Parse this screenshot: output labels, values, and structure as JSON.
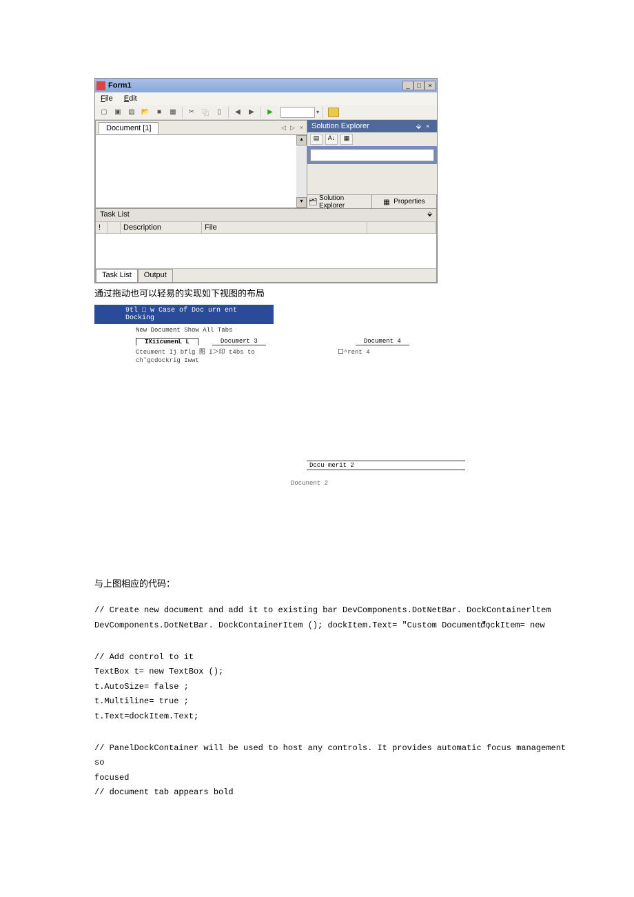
{
  "form1": {
    "title": "Form1",
    "menu": {
      "file": "File",
      "edit": "Edit"
    },
    "doc_tab": "Document [1]",
    "solution": {
      "title": "Solution Explorer",
      "tab1": "Solution Explorer",
      "tab2": "Properties"
    },
    "tasklist": {
      "title": "Task List",
      "cols": {
        "desc": "Description",
        "file": "File"
      },
      "tabs": {
        "tasklist": "Task List",
        "output": "Output"
      }
    }
  },
  "caption1": "通过拖动也可以轻易的实现如下视图的布局",
  "fig2": {
    "title": "9tl □ w Case of Doc urn ent Docking",
    "sub": "New Document Show All Tabs",
    "tabs": [
      "IXiicumenL L",
      "Documert 3",
      "Document 4"
    ],
    "row1_left": "Cteument Ij bflg 图 I＞印 t4bs to",
    "row1_right": "口^rent 4",
    "row2_left": "ch˜gcdockrig Iwwt",
    "tab2": "Dccu merit 2",
    "lbl2": "Docunent 2"
  },
  "code": {
    "heading": "与上图相应的代码：",
    "l1": "// Create new document and add it to existing bar DevComponents.DotNetBar. DockContainerltem",
    "l2": "DevComponents.DotNetBar. DockContainerItem (); dockItem.Text= \"Custom Document\";",
    "l2r": "dockItem= new",
    "l3": "// Add control to it",
    "l4": "TextBox t= new TextBox ();",
    "l5": "t.AutoSize= false ;",
    "l6": "t.Multiline= true ;",
    "l7": "t.Text=dockItem.Text;",
    "l8": "// PanelDockContainer will be used to host any controls. It provides automatic focus management so",
    "l9": "focused",
    "l10": "// document tab appears bold"
  }
}
